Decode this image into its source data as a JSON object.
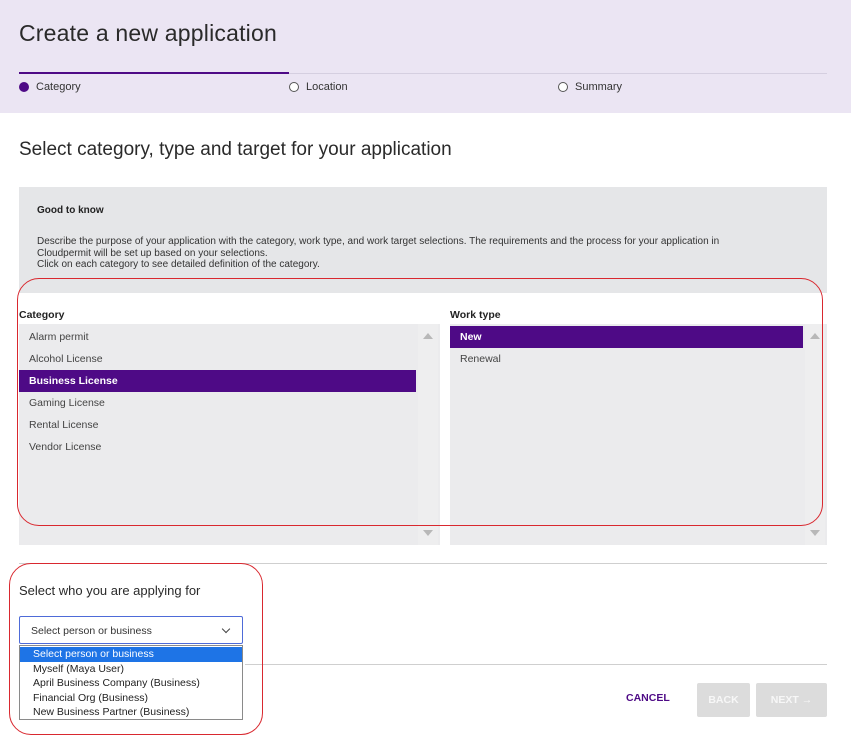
{
  "page": {
    "title": "Create a new application"
  },
  "steps": [
    {
      "label": "Category",
      "active": true
    },
    {
      "label": "Location",
      "active": false
    },
    {
      "label": "Summary",
      "active": false
    }
  ],
  "section_heading": "Select category, type and target for your application",
  "info": {
    "title": "Good to know",
    "lines": [
      "Describe the purpose of your application with the category, work type, and work target selections. The requirements and the process for your application in",
      "Cloudpermit will be set up based on your selections.",
      "Click on each category to see detailed definition of the category."
    ]
  },
  "category": {
    "label": "Category",
    "items": [
      "Alarm permit",
      "Alcohol License",
      "Business License",
      "Gaming License",
      "Rental License",
      "Vendor License"
    ],
    "selected": "Business License"
  },
  "work_type": {
    "label": "Work type",
    "items": [
      "New",
      "Renewal"
    ],
    "selected": "New"
  },
  "applicant": {
    "label": "Select who you are applying for",
    "select_value": "Select person or business",
    "options": [
      "Select person or business",
      "Myself (Maya User)",
      "April Business Company (Business)",
      "Financial Org (Business)",
      "New Business Partner (Business)"
    ],
    "highlighted": "Select person or business"
  },
  "actions": {
    "cancel": "CANCEL",
    "back": "BACK",
    "next": "NEXT →"
  },
  "colors": {
    "accent": "#4e0a86",
    "header_bg": "#ebe5f3",
    "annotation": "#d9282f",
    "dropdown_highlight": "#1e74e6"
  }
}
